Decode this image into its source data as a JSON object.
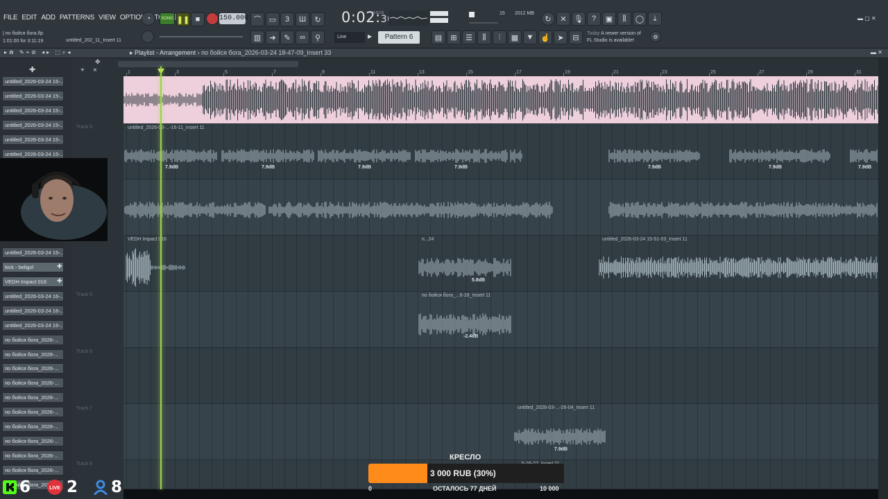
{
  "menu": [
    "FILE",
    "EDIT",
    "ADD",
    "PATTERNS",
    "VIEW",
    "OPTIONS",
    "TOOLS",
    "HELP"
  ],
  "transport": {
    "song_label": "SONG",
    "tempo": "150.000",
    "time_main": "0:02",
    "time_sub": "30",
    "time_unit": "M:S:CS"
  },
  "project": {
    "file": "по бойся бога.flp",
    "position": "1:01:00 for 3:11:19",
    "hint": "untitled_202_11_Insert 11"
  },
  "memory": {
    "cpu": "15",
    "ram": "2012 MB"
  },
  "pattern_selector": "Pattern 6",
  "snap": "Line",
  "news": {
    "when": "Today",
    "text1": "A newer version of",
    "text2": "FL Studio is available!"
  },
  "playlist": {
    "title": "Playlist - Arrangement",
    "breadcrumb": "по бойся бога_2026-03-24 18-47-09_Insert 33"
  },
  "ruler_marks": [
    "1",
    "3",
    "5",
    "7",
    "9",
    "11",
    "13",
    "15",
    "17",
    "19",
    "21",
    "23",
    "25",
    "27",
    "29",
    "31"
  ],
  "browser_items": [
    "untitled_2026-03-24 15-...",
    "untitled_2026-03-24 15-...",
    "untitled_2026-03-24 15-...",
    "untitled_2026-03-24 15-...",
    "untitled_2026-03-24 15-...",
    "untitled_2026-03-24 15-...",
    "untitled_2026-03-24 15-...",
    "kick - beligol",
    "VEDH Impact 016",
    "untitled_2026-03-24 16-...",
    "untitled_2026-03-24 16-...",
    "untitled_2026-03-24 16-...",
    "по бойся бога_2026-...",
    "по бойся бога_2026-...",
    "по бойся бога_2026-...",
    "по бойся бога_2026-...",
    "по бойся бога_2026-...",
    "по бойся бога_2026-...",
    "по бойся бога_2026-...",
    "по бойся бога_2026-...",
    "по бойся бога_2026-...",
    "по бойся бога_2026-...",
    "по бойся бога_2026-..."
  ],
  "track_labels": [
    "Track 3",
    "Track 5",
    "Track 6",
    "Track 7",
    "Track 8"
  ],
  "clips": {
    "track2": "untitled_2026-03-...-16-11_Insert 11",
    "track4_left": "VEDH Impact 016",
    "track4_mid": "п...24",
    "track4_right": "untitled_2026-03-24 15-51-03_Insert 11",
    "track5": "по бойся бога_...6-28_Insert 11",
    "track7": "untitled_2026-03-...-26-04_Insert 11",
    "track8": "...5-26-27_Insert 11"
  },
  "db_labels": {
    "track2": "7.9dB",
    "track4": "5.8dB",
    "track5": "-2.4dB",
    "track7": "7.9dB"
  },
  "donation": {
    "title": "КРЕСЛО",
    "amount": "3 000 RUB (30%)",
    "progress": 0.3,
    "min": "0",
    "remaining": "ОСТАЛОСЬ 77 ДНЕЙ",
    "max": "10 000"
  },
  "viewers": {
    "kick": "6",
    "live": "2",
    "users": "8",
    "live_label": "LIVE"
  },
  "colors": {
    "master_wave": "#eecfdc",
    "playhead": "#9cd24c",
    "goal_fill": "#ff8c1a",
    "kick_green": "#53fc18",
    "live_red": "#e0323b",
    "users_blue": "#3d8be6"
  }
}
